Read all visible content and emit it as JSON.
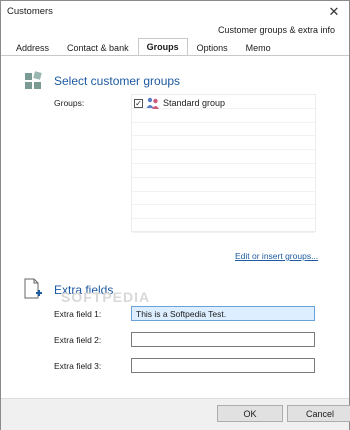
{
  "window": {
    "title": "Customers"
  },
  "header": {
    "info": "Customer groups & extra info"
  },
  "tabs": [
    {
      "label": "Address"
    },
    {
      "label": "Contact & bank"
    },
    {
      "label": "Groups"
    },
    {
      "label": "Options"
    },
    {
      "label": "Memo"
    }
  ],
  "groups_section": {
    "title": "Select customer groups",
    "groups_label": "Groups:",
    "items": [
      {
        "label": "Standard group",
        "checked": true
      }
    ],
    "edit_link": "Edit or insert groups..."
  },
  "extra_section": {
    "title": "Extra fields",
    "fields": [
      {
        "label": "Extra field 1:",
        "value": "This is a Softpedia Test."
      },
      {
        "label": "Extra field 2:",
        "value": ""
      },
      {
        "label": "Extra field 3:",
        "value": ""
      }
    ]
  },
  "footer": {
    "ok_label": "OK",
    "cancel_label": "Cancel"
  },
  "watermark": "SOFTPEDIA",
  "colors": {
    "accent": "#1e5aa0",
    "focus_field": "#dceeff"
  }
}
